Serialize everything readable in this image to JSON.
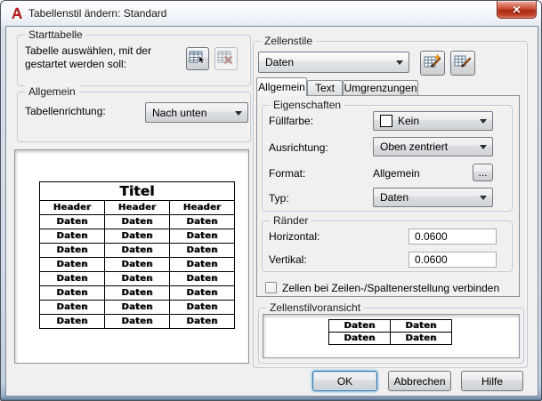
{
  "window": {
    "title": "Tabellenstil ändern: Standard",
    "close_glyph": "✕"
  },
  "left": {
    "starttabelle": {
      "label": "Starttabelle",
      "desc1": "Tabelle auswählen, mit der",
      "desc2": "gestartet werden soll:"
    },
    "allgemein": {
      "label": "Allgemein",
      "direction_label": "Tabellenrichtung:",
      "direction_value": "Nach unten"
    },
    "preview": {
      "title": "Titel",
      "headers": [
        "Header",
        "Header",
        "Header"
      ],
      "rows": [
        [
          "Daten",
          "Daten",
          "Daten"
        ],
        [
          "Daten",
          "Daten",
          "Daten"
        ],
        [
          "Daten",
          "Daten",
          "Daten"
        ],
        [
          "Daten",
          "Daten",
          "Daten"
        ],
        [
          "Daten",
          "Daten",
          "Daten"
        ],
        [
          "Daten",
          "Daten",
          "Daten"
        ],
        [
          "Daten",
          "Daten",
          "Daten"
        ],
        [
          "Daten",
          "Daten",
          "Daten"
        ]
      ]
    }
  },
  "cellstyles": {
    "label": "Zellenstile",
    "style_value": "Daten",
    "tabs": [
      {
        "label": "Allgemein"
      },
      {
        "label": "Text"
      },
      {
        "label": "Umgrenzungen"
      }
    ],
    "properties": {
      "label": "Eigenschaften",
      "fill_label": "Füllfarbe:",
      "fill_value": "Kein",
      "align_label": "Ausrichtung:",
      "align_value": "Oben zentriert",
      "format_label": "Format:",
      "format_value": "Allgemein",
      "format_button": "...",
      "type_label": "Typ:",
      "type_value": "Daten"
    },
    "margins": {
      "label": "Ränder",
      "h_label": "Horizontal:",
      "h_value": "0.0600",
      "v_label": "Vertikal:",
      "v_value": "0.0600"
    },
    "merge_checkbox_label": "Zellen bei Zeilen-/Spaltenerstellung verbinden",
    "preview": {
      "label": "Zellenstilvoransicht",
      "rows": [
        [
          "Daten",
          "Daten"
        ],
        [
          "Daten",
          "Daten"
        ]
      ]
    }
  },
  "footer": {
    "ok": "OK",
    "cancel": "Abbrechen",
    "help": "Hilfe"
  },
  "colors": {
    "dialog_bg": "#f0f0f0",
    "close_red": "#ad2b12",
    "logo_red": "#b01e24"
  }
}
